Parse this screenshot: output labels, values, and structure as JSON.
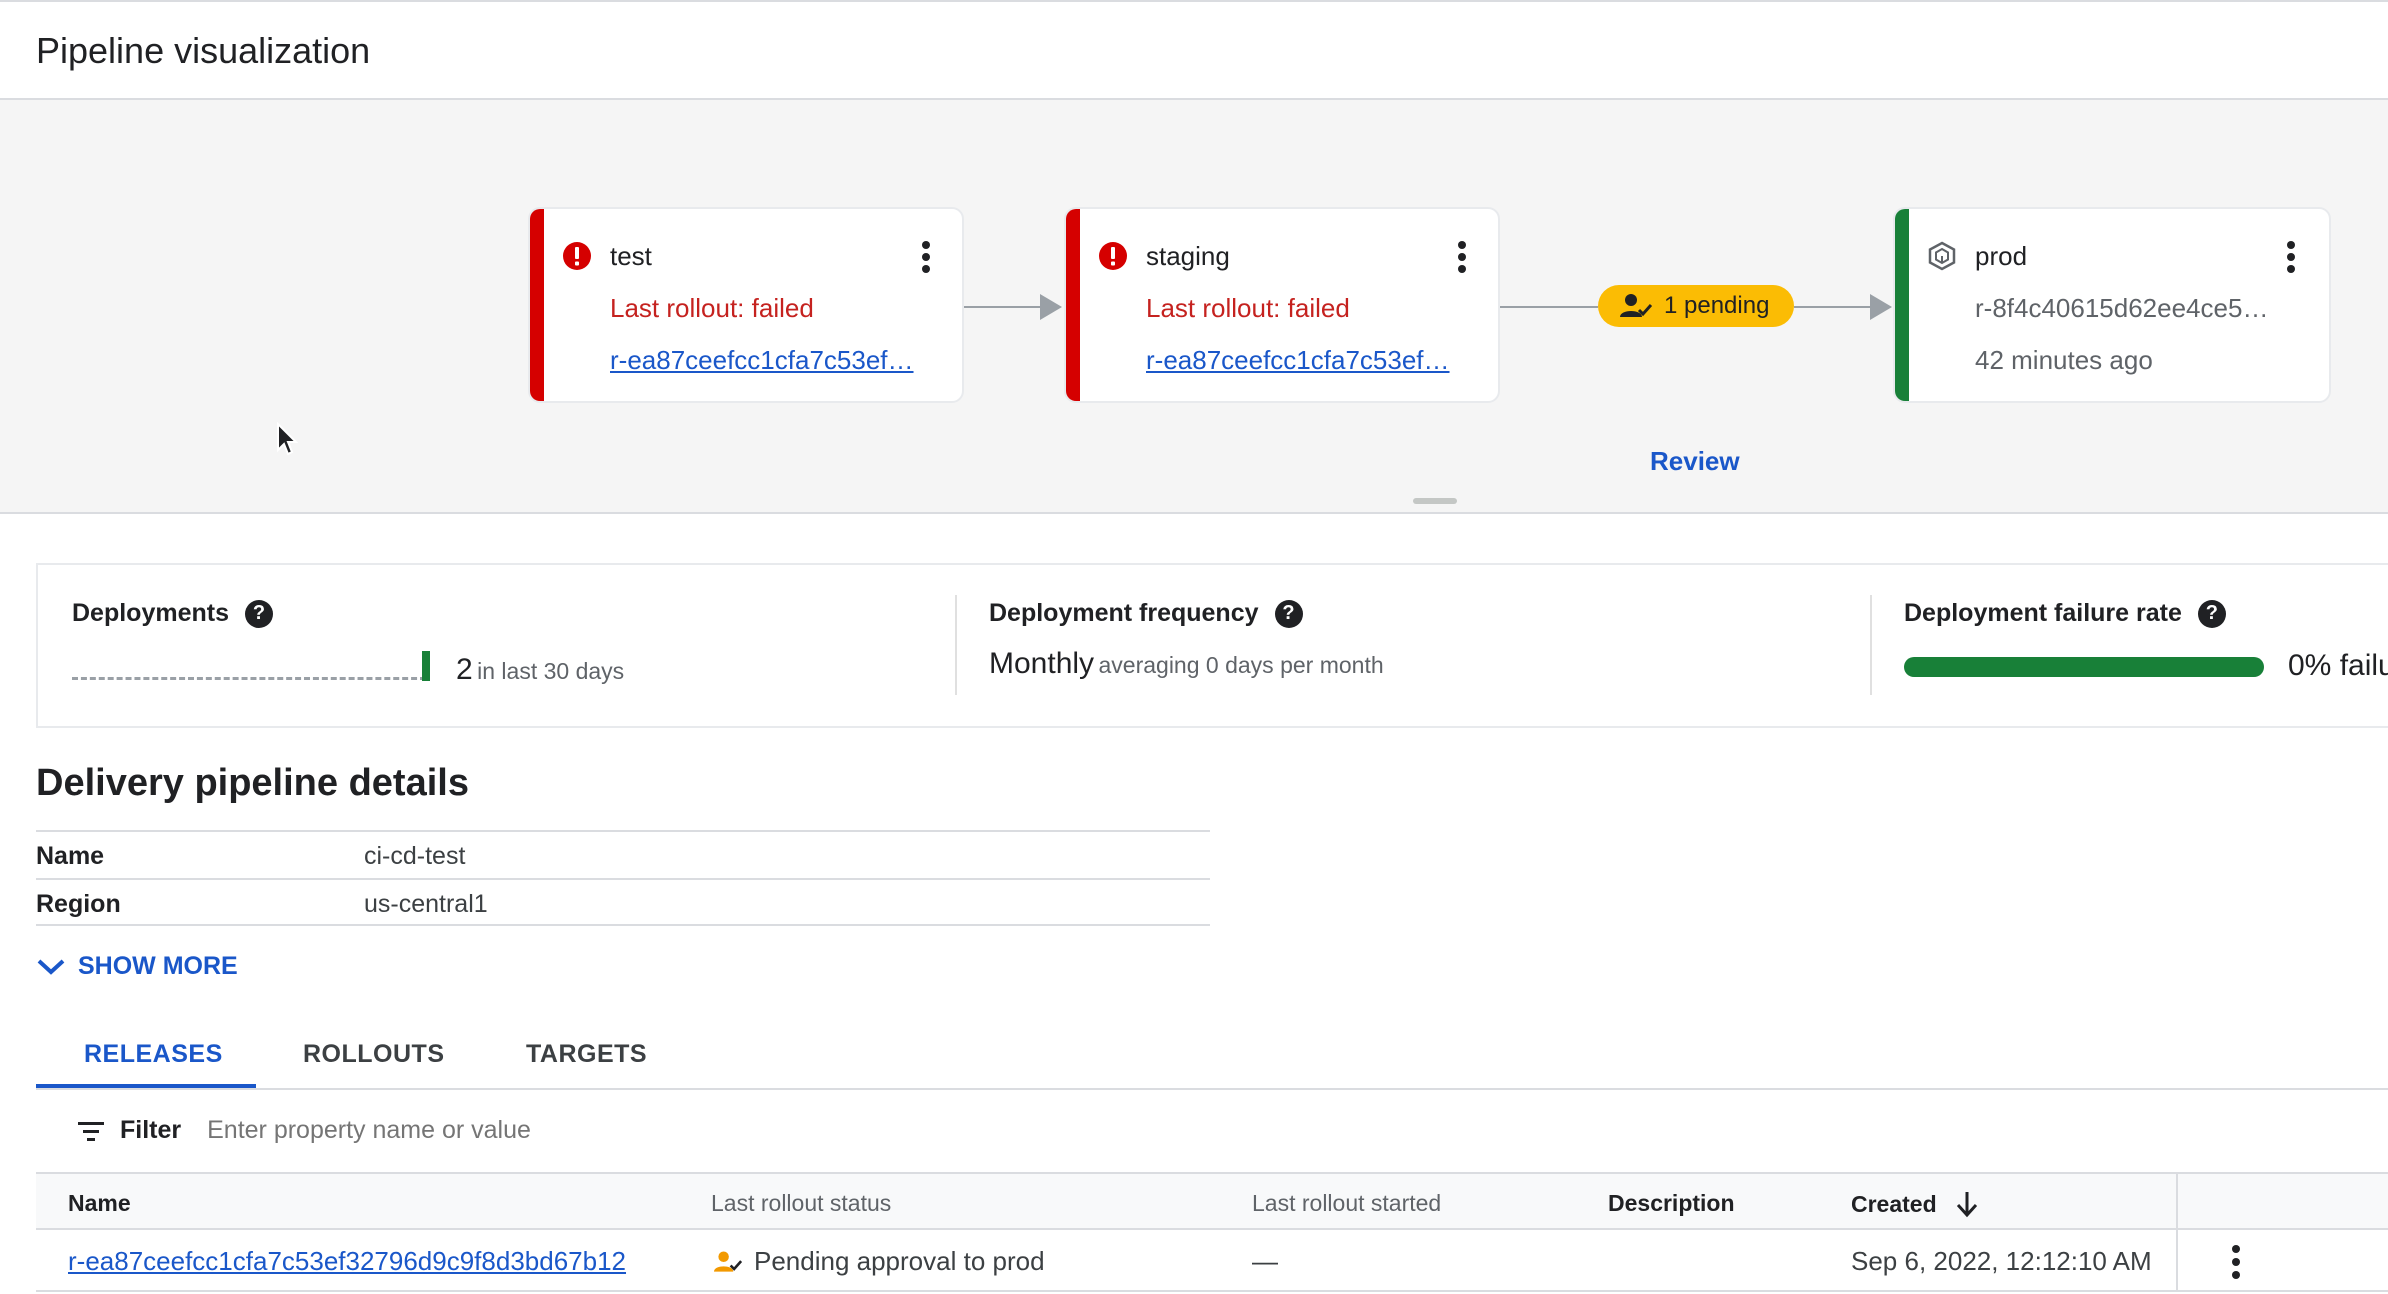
{
  "header": {
    "title": "Pipeline visualization"
  },
  "pipeline": {
    "stages": [
      {
        "name": "test",
        "status": "Last rollout: failed",
        "release": "r-ea87ceefcc1cfa7c53ef…"
      },
      {
        "name": "staging",
        "status": "Last rollout: failed",
        "release": "r-ea87ceefcc1cfa7c53ef…"
      },
      {
        "name": "prod",
        "release": "r-8f4c40615d62ee4ce5…",
        "time": "42 minutes ago"
      }
    ],
    "pending_label": "1 pending",
    "review_label": "Review"
  },
  "metrics": {
    "deployments": {
      "title": "Deployments",
      "count": "2",
      "suffix": "in last 30 days"
    },
    "frequency": {
      "title": "Deployment frequency",
      "value": "Monthly",
      "suffix": "averaging 0 days per month"
    },
    "failure_rate": {
      "title": "Deployment failure rate",
      "value": "0% failu",
      "fraction": 0
    }
  },
  "details": {
    "title": "Delivery pipeline details",
    "rows": [
      {
        "key": "Name",
        "value": "ci-cd-test"
      },
      {
        "key": "Region",
        "value": "us-central1"
      }
    ],
    "show_more": "SHOW MORE"
  },
  "tabs": [
    {
      "label": "RELEASES",
      "active": true
    },
    {
      "label": "ROLLOUTS",
      "active": false
    },
    {
      "label": "TARGETS",
      "active": false
    }
  ],
  "filter": {
    "label": "Filter",
    "placeholder": "Enter property name or value"
  },
  "table": {
    "columns": [
      "Name",
      "Last rollout status",
      "Last rollout started",
      "Description",
      "Created"
    ],
    "rows": [
      {
        "name": "r-ea87ceefcc1cfa7c53ef32796d9c9f8d3bd67b12",
        "status": "Pending approval to prod",
        "started": "—",
        "description": "",
        "created": "Sep 6, 2022, 12:12:10 AM"
      }
    ]
  },
  "colors": {
    "failed": "#d50000",
    "success": "#188038",
    "pending": "#fbbc04",
    "link": "#1a57c9"
  }
}
